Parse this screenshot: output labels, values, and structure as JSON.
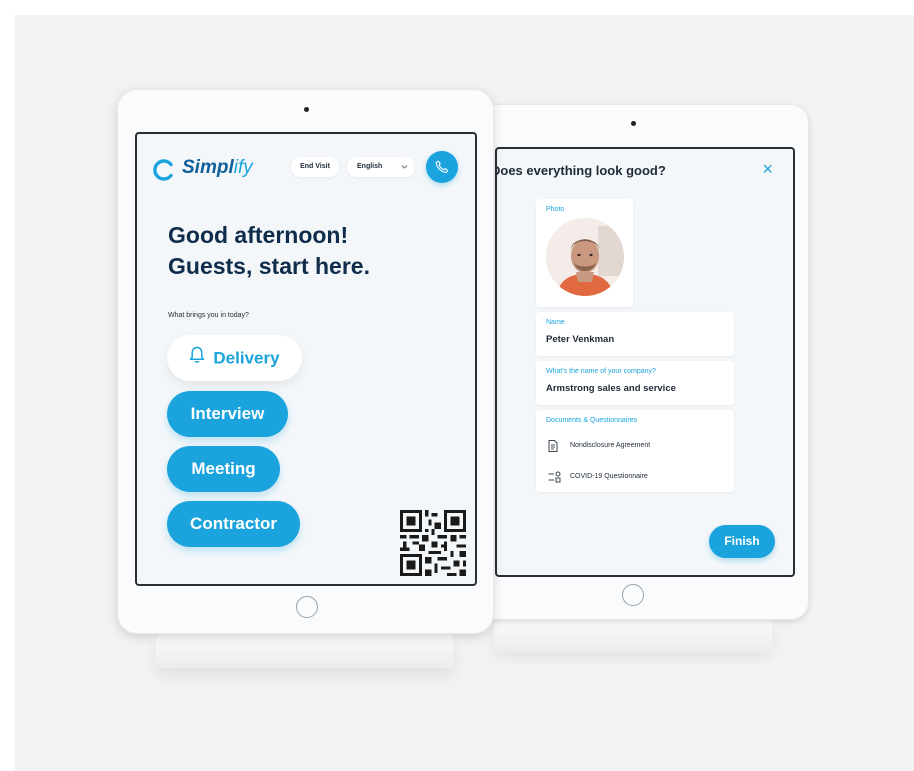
{
  "kiosk": {
    "logo_text": "Simpl",
    "logo_text_light": "ify",
    "end_visit_label": "End Visit",
    "language_value": "English",
    "greeting_line1": "Good afternoon!",
    "greeting_line2": "Guests, start here.",
    "prompt": "What brings you in today?",
    "options": [
      "Delivery",
      "Interview",
      "Meeting",
      "Contractor"
    ],
    "selected_option": "Delivery"
  },
  "review": {
    "title": "Does everything look good?",
    "photo_label": "Photo",
    "name_label": "Name",
    "name_value": "Peter Venkman",
    "company_label": "What's the name of your company?",
    "company_value": "Armstrong sales and service",
    "documents_label": "Documents & Questionnaires",
    "documents": [
      "Nondisclosure Agreement",
      "COVID-19 Questionnaire"
    ],
    "finish_label": "Finish"
  },
  "colors": {
    "accent": "#1aa3dc",
    "brand_dark": "#0e5f9a",
    "text_dark": "#0f2d4a",
    "screen_bg": "#f4f7fa"
  },
  "icons": [
    "logo-mark-icon",
    "phone-icon",
    "chevron-down-icon",
    "bell-icon",
    "close-icon",
    "document-icon",
    "checklist-icon",
    "qr-code-icon",
    "home-button-icon"
  ]
}
